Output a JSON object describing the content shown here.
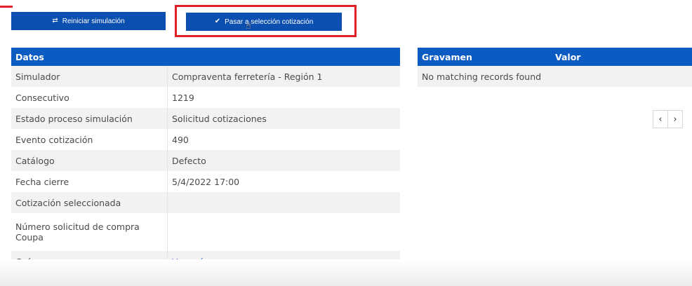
{
  "toolbar": {
    "reiniciar_label": "Reiniciar simulación",
    "pasar_label": "Pasar a selección cotización"
  },
  "datos": {
    "header": "Datos",
    "rows": [
      {
        "label": "Simulador",
        "value": "Compraventa ferretería - Región 1"
      },
      {
        "label": "Consecutivo",
        "value": "1219"
      },
      {
        "label": "Estado proceso simulación",
        "value": "Solicitud cotizaciones"
      },
      {
        "label": "Evento cotización",
        "value": "490"
      },
      {
        "label": "Catálogo",
        "value": "Defecto"
      },
      {
        "label": "Fecha cierre",
        "value": "5/4/2022 17:00"
      },
      {
        "label": "Cotización seleccionada",
        "value": ""
      },
      {
        "label": "Número solicitud de compra Coupa",
        "value": ""
      },
      {
        "label": "Guía",
        "value": "Ver guía"
      }
    ]
  },
  "gravamen": {
    "col1": "Gravamen",
    "col2": "Valor",
    "empty_text": "No matching records found"
  },
  "pager": {
    "prev": "‹",
    "next": "›"
  },
  "colors": {
    "primary": "#0b4fb1",
    "header": "#0b5bc2",
    "highlight": "#e01f26",
    "link": "#2a6ed0"
  }
}
